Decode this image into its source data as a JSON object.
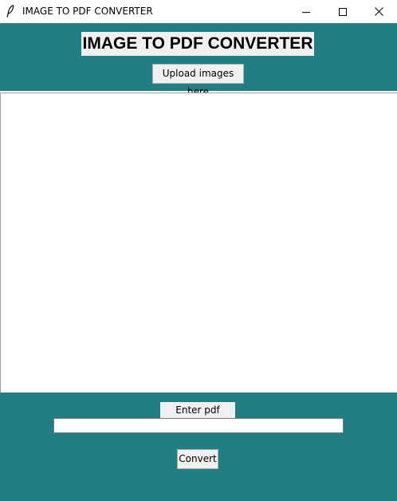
{
  "window": {
    "title": "IMAGE TO PDF CONVERTER",
    "icon": "feather-icon",
    "controls": [
      "minimize-icon",
      "maximize-icon",
      "close-icon"
    ]
  },
  "header": {
    "title": "IMAGE TO PDF CONVERTER",
    "upload_label": "Upload images here"
  },
  "image_list": {
    "items": []
  },
  "footer": {
    "pdf_name_label": "Enter pdf name:",
    "pdf_name_value": "",
    "convert_label": "Convert"
  },
  "colors": {
    "panel_bg": "#217e84",
    "widget_bg": "#f0f0f0"
  }
}
